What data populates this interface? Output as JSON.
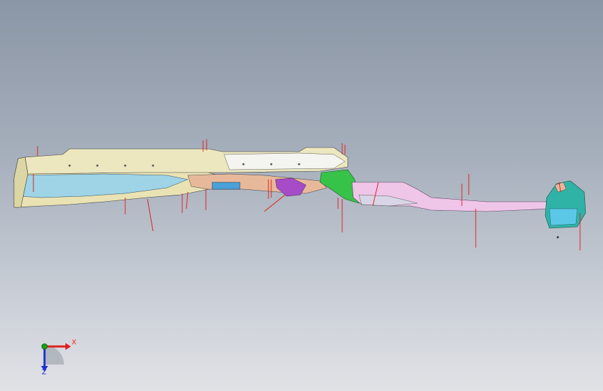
{
  "triad": {
    "x_label": "X",
    "y_label": "Y",
    "z_label": "Z"
  },
  "colors": {
    "background_top": "#8b96a6",
    "background_bottom": "#e0e2e6",
    "rail_yellow": "#e8e2b0",
    "panel_blue": "#9fd3e6",
    "panel_pink": "#f0c2e6",
    "panel_green": "#37c24a",
    "panel_purple": "#a64cc8",
    "bracket_teal": "#2fb3a6",
    "marker_red": "#e02020"
  }
}
